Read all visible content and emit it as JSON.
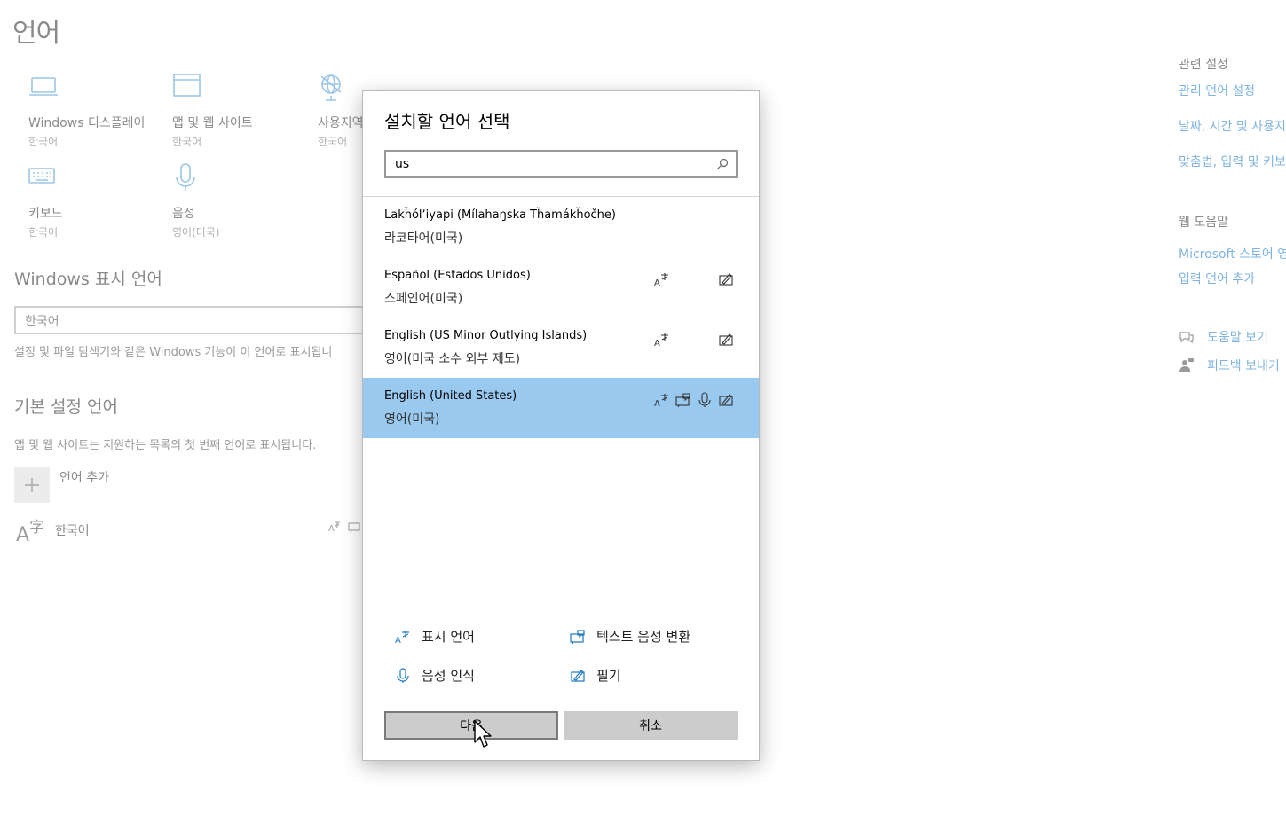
{
  "page": {
    "title": "언어"
  },
  "tiles": [
    {
      "label": "Windows 디스플레이",
      "value": "한국어",
      "icon": "monitor-icon"
    },
    {
      "label": "앱 및 웹 사이트",
      "value": "한국어",
      "icon": "window-icon"
    },
    {
      "label": "사용지역",
      "value": "한국어",
      "icon": "globe-icon"
    },
    {
      "label": "키보드",
      "value": "한국어",
      "icon": "keyboard-icon"
    },
    {
      "label": "음성",
      "value": "영어(미국)",
      "icon": "microphone-icon"
    }
  ],
  "display_language": {
    "heading": "Windows 표시 언어",
    "selected": "한국어",
    "description": "설정 및 파일 탐색기와 같은 Windows 기능이 이 언어로 표시됩니"
  },
  "preferred_languages": {
    "heading": "기본 설정 언어",
    "description": "앱 및 웹 사이트는 지원하는 목록의 첫 번째 언어로 표시됩니다.",
    "add_label": "언어 추가",
    "items": [
      {
        "name": "한국어"
      }
    ]
  },
  "related": {
    "heading": "관련 설정",
    "links": [
      "관리 언어 설정",
      "날짜, 시간 및 사용지",
      "맞춤법, 입력 및 키보"
    ]
  },
  "web_help": {
    "heading": "웹 도움말",
    "links": [
      "Microsoft 스토어 영",
      "입력 언어 추가"
    ]
  },
  "help": {
    "get_help": "도움말 보기",
    "feedback": "피드백 보내기"
  },
  "dialog": {
    "title": "설치할 언어 선택",
    "search": {
      "value": "us",
      "placeholder": ""
    },
    "languages": [
      {
        "name": "Lakȟólʼiyapi (Mílahaŋska Tȟamákȟočhe)",
        "sub": "라코타어(미국)",
        "features": []
      },
      {
        "name": "Español (Estados Unidos)",
        "sub": "스페인어(미국)",
        "features": [
          "display",
          "handwriting"
        ]
      },
      {
        "name": "English (US Minor Outlying Islands)",
        "sub": "영어(미국 소수 외부 제도)",
        "features": [
          "display",
          "handwriting"
        ]
      },
      {
        "name": "English (United States)",
        "sub": "영어(미국)",
        "features": [
          "display",
          "text-to-speech",
          "speech",
          "handwriting"
        ],
        "selected": true
      }
    ],
    "legend": {
      "display": "표시 언어",
      "tts": "텍스트 음성 변환",
      "speech": "음성 인식",
      "handwriting": "필기"
    },
    "next_label": "다음",
    "cancel_label": "취소"
  },
  "colors": {
    "accent": "#1a78c2",
    "selection": "#99c9ef",
    "link": "#7fb4e0"
  }
}
